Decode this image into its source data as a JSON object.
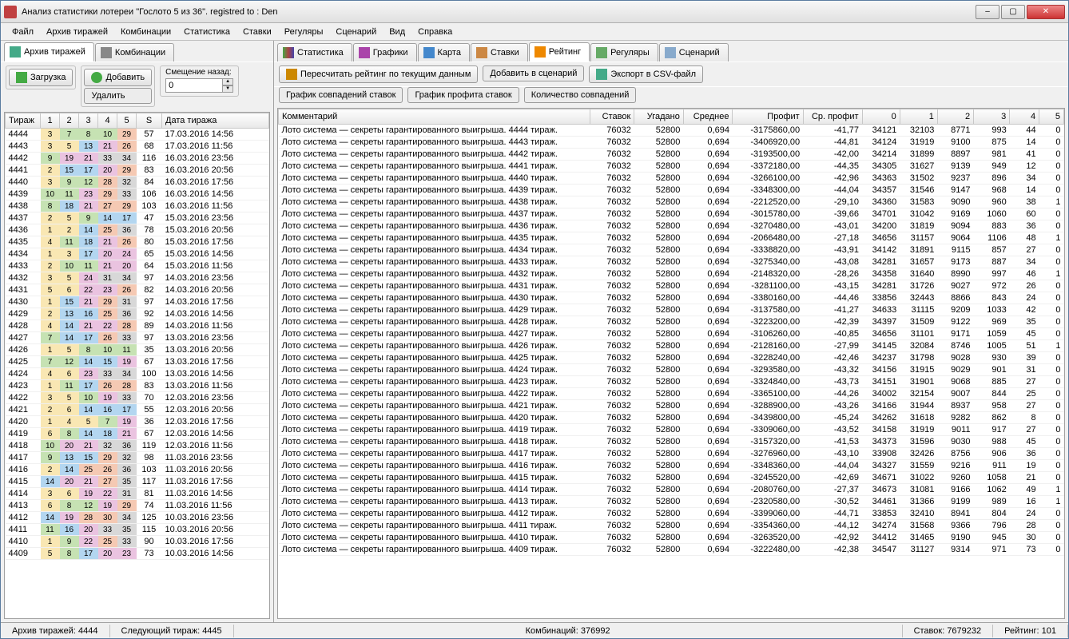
{
  "title": "Анализ статистики лотереи \"Гослото 5 из 36\". registred to : Den",
  "menu": [
    "Файл",
    "Архив тиражей",
    "Комбинации",
    "Статистика",
    "Ставки",
    "Регуляры",
    "Сценарий",
    "Вид",
    "Справка"
  ],
  "leftTabs": [
    {
      "label": "Архив тиражей"
    },
    {
      "label": "Комбинации"
    }
  ],
  "rightTabs": [
    {
      "label": "Статистика"
    },
    {
      "label": "Графики"
    },
    {
      "label": "Карта"
    },
    {
      "label": "Ставки"
    },
    {
      "label": "Рейтинг"
    },
    {
      "label": "Регуляры"
    },
    {
      "label": "Сценарий"
    }
  ],
  "leftToolbar": {
    "load": "Загрузка",
    "add": "Добавить",
    "del": "Удалить",
    "offsetLabel": "Смещение назад:",
    "offsetValue": "0"
  },
  "rightToolbar": {
    "recalc": "Пересчитать рейтинг по текущим данным",
    "addScenario": "Добавить в сценарий",
    "export": "Экспорт в CSV-файл",
    "g1": "График совпадений ставок",
    "g2": "График профита ставок",
    "g3": "Количество совпадений"
  },
  "leftHeaders": [
    "Тираж",
    "1",
    "2",
    "3",
    "4",
    "5",
    "S",
    "Дата тиража"
  ],
  "rightHeaders": [
    "Комментарий",
    "Ставок",
    "Угадано",
    "Среднее",
    "Профит",
    "Ср. профит",
    "0",
    "1",
    "2",
    "3",
    "4",
    "5"
  ],
  "draws": [
    {
      "t": "4444",
      "n": [
        3,
        7,
        8,
        10,
        29
      ],
      "s": 57,
      "d": "17.03.2016 14:56"
    },
    {
      "t": "4443",
      "n": [
        3,
        5,
        13,
        21,
        26
      ],
      "s": 68,
      "d": "17.03.2016 11:56"
    },
    {
      "t": "4442",
      "n": [
        9,
        19,
        21,
        33,
        34
      ],
      "s": 116,
      "d": "16.03.2016 23:56"
    },
    {
      "t": "4441",
      "n": [
        2,
        15,
        17,
        20,
        29
      ],
      "s": 83,
      "d": "16.03.2016 20:56"
    },
    {
      "t": "4440",
      "n": [
        3,
        9,
        12,
        28,
        32
      ],
      "s": 84,
      "d": "16.03.2016 17:56"
    },
    {
      "t": "4439",
      "n": [
        10,
        11,
        23,
        29,
        33
      ],
      "s": 106,
      "d": "16.03.2016 14:56"
    },
    {
      "t": "4438",
      "n": [
        8,
        18,
        21,
        27,
        29
      ],
      "s": 103,
      "d": "16.03.2016 11:56"
    },
    {
      "t": "4437",
      "n": [
        2,
        5,
        9,
        14,
        17
      ],
      "s": 47,
      "d": "15.03.2016 23:56"
    },
    {
      "t": "4436",
      "n": [
        1,
        2,
        14,
        25,
        36
      ],
      "s": 78,
      "d": "15.03.2016 20:56"
    },
    {
      "t": "4435",
      "n": [
        4,
        11,
        18,
        21,
        26
      ],
      "s": 80,
      "d": "15.03.2016 17:56"
    },
    {
      "t": "4434",
      "n": [
        1,
        3,
        17,
        20,
        24
      ],
      "s": 65,
      "d": "15.03.2016 14:56"
    },
    {
      "t": "4433",
      "n": [
        2,
        10,
        11,
        21,
        20
      ],
      "s": 64,
      "d": "15.03.2016 11:56"
    },
    {
      "t": "4432",
      "n": [
        3,
        5,
        24,
        31,
        34
      ],
      "s": 97,
      "d": "14.03.2016 23:56"
    },
    {
      "t": "4431",
      "n": [
        5,
        6,
        22,
        23,
        26
      ],
      "s": 82,
      "d": "14.03.2016 20:56"
    },
    {
      "t": "4430",
      "n": [
        1,
        15,
        21,
        29,
        31
      ],
      "s": 97,
      "d": "14.03.2016 17:56"
    },
    {
      "t": "4429",
      "n": [
        2,
        13,
        16,
        25,
        36
      ],
      "s": 92,
      "d": "14.03.2016 14:56"
    },
    {
      "t": "4428",
      "n": [
        4,
        14,
        21,
        22,
        28
      ],
      "s": 89,
      "d": "14.03.2016 11:56"
    },
    {
      "t": "4427",
      "n": [
        7,
        14,
        17,
        26,
        33
      ],
      "s": 97,
      "d": "13.03.2016 23:56"
    },
    {
      "t": "4426",
      "n": [
        1,
        5,
        8,
        10,
        11
      ],
      "s": 35,
      "d": "13.03.2016 20:56"
    },
    {
      "t": "4425",
      "n": [
        7,
        12,
        14,
        15,
        19
      ],
      "s": 67,
      "d": "13.03.2016 17:56"
    },
    {
      "t": "4424",
      "n": [
        4,
        6,
        23,
        33,
        34
      ],
      "s": 100,
      "d": "13.03.2016 14:56"
    },
    {
      "t": "4423",
      "n": [
        1,
        11,
        17,
        26,
        28
      ],
      "s": 83,
      "d": "13.03.2016 11:56"
    },
    {
      "t": "4422",
      "n": [
        3,
        5,
        10,
        19,
        33
      ],
      "s": 70,
      "d": "12.03.2016 23:56"
    },
    {
      "t": "4421",
      "n": [
        2,
        6,
        14,
        16,
        17
      ],
      "s": 55,
      "d": "12.03.2016 20:56"
    },
    {
      "t": "4420",
      "n": [
        1,
        4,
        5,
        7,
        19
      ],
      "s": 36,
      "d": "12.03.2016 17:56"
    },
    {
      "t": "4419",
      "n": [
        6,
        8,
        14,
        18,
        21
      ],
      "s": 67,
      "d": "12.03.2016 14:56"
    },
    {
      "t": "4418",
      "n": [
        10,
        20,
        21,
        32,
        36
      ],
      "s": 119,
      "d": "12.03.2016 11:56"
    },
    {
      "t": "4417",
      "n": [
        9,
        13,
        15,
        29,
        32
      ],
      "s": 98,
      "d": "11.03.2016 23:56"
    },
    {
      "t": "4416",
      "n": [
        2,
        14,
        25,
        26,
        36
      ],
      "s": 103,
      "d": "11.03.2016 20:56"
    },
    {
      "t": "4415",
      "n": [
        14,
        20,
        21,
        27,
        35
      ],
      "s": 117,
      "d": "11.03.2016 17:56"
    },
    {
      "t": "4414",
      "n": [
        3,
        6,
        19,
        22,
        31
      ],
      "s": 81,
      "d": "11.03.2016 14:56"
    },
    {
      "t": "4413",
      "n": [
        6,
        8,
        12,
        19,
        29
      ],
      "s": 74,
      "d": "11.03.2016 11:56"
    },
    {
      "t": "4412",
      "n": [
        14,
        19,
        28,
        30,
        34
      ],
      "s": 125,
      "d": "10.03.2016 23:56"
    },
    {
      "t": "4411",
      "n": [
        11,
        16,
        20,
        33,
        35
      ],
      "s": 115,
      "d": "10.03.2016 20:56"
    },
    {
      "t": "4410",
      "n": [
        1,
        9,
        22,
        25,
        33
      ],
      "s": 90,
      "d": "10.03.2016 17:56"
    },
    {
      "t": "4409",
      "n": [
        5,
        8,
        17,
        20,
        23
      ],
      "s": 73,
      "d": "10.03.2016 14:56"
    }
  ],
  "ratings": [
    {
      "c": "Лото система — секреты гарантированного выигрыша. 4444 тираж.",
      "st": "76032",
      "ug": "52800",
      "sr": "0,694",
      "pr": "-3175860,00",
      "sp": "-41,77",
      "m": [
        34121,
        32103,
        8771,
        993,
        44,
        0
      ]
    },
    {
      "c": "Лото система — секреты гарантированного выигрыша. 4443 тираж.",
      "st": "76032",
      "ug": "52800",
      "sr": "0,694",
      "pr": "-3406920,00",
      "sp": "-44,81",
      "m": [
        34124,
        31919,
        9100,
        875,
        14,
        0
      ]
    },
    {
      "c": "Лото система — секреты гарантированного выигрыша. 4442 тираж.",
      "st": "76032",
      "ug": "52800",
      "sr": "0,694",
      "pr": "-3193500,00",
      "sp": "-42,00",
      "m": [
        34214,
        31899,
        8897,
        981,
        41,
        0
      ]
    },
    {
      "c": "Лото система — секреты гарантированного выигрыша. 4441 тираж.",
      "st": "76032",
      "ug": "52800",
      "sr": "0,694",
      "pr": "-3372180,00",
      "sp": "-44,35",
      "m": [
        34305,
        31627,
        9139,
        949,
        12,
        0
      ]
    },
    {
      "c": "Лото система — секреты гарантированного выигрыша. 4440 тираж.",
      "st": "76032",
      "ug": "52800",
      "sr": "0,694",
      "pr": "-3266100,00",
      "sp": "-42,96",
      "m": [
        34363,
        31502,
        9237,
        896,
        34,
        0
      ]
    },
    {
      "c": "Лото система — секреты гарантированного выигрыша. 4439 тираж.",
      "st": "76032",
      "ug": "52800",
      "sr": "0,694",
      "pr": "-3348300,00",
      "sp": "-44,04",
      "m": [
        34357,
        31546,
        9147,
        968,
        14,
        0
      ]
    },
    {
      "c": "Лото система — секреты гарантированного выигрыша. 4438 тираж.",
      "st": "76032",
      "ug": "52800",
      "sr": "0,694",
      "pr": "-2212520,00",
      "sp": "-29,10",
      "m": [
        34360,
        31583,
        9090,
        960,
        38,
        1
      ]
    },
    {
      "c": "Лото система — секреты гарантированного выигрыша. 4437 тираж.",
      "st": "76032",
      "ug": "52800",
      "sr": "0,694",
      "pr": "-3015780,00",
      "sp": "-39,66",
      "m": [
        34701,
        31042,
        9169,
        1060,
        60,
        0
      ]
    },
    {
      "c": "Лото система — секреты гарантированного выигрыша. 4436 тираж.",
      "st": "76032",
      "ug": "52800",
      "sr": "0,694",
      "pr": "-3270480,00",
      "sp": "-43,01",
      "m": [
        34200,
        31819,
        9094,
        883,
        36,
        0
      ]
    },
    {
      "c": "Лото система — секреты гарантированного выигрыша. 4435 тираж.",
      "st": "76032",
      "ug": "52800",
      "sr": "0,694",
      "pr": "-2066480,00",
      "sp": "-27,18",
      "m": [
        34656,
        31157,
        9064,
        1106,
        48,
        1
      ]
    },
    {
      "c": "Лото система — секреты гарантированного выигрыша. 4434 тираж.",
      "st": "76032",
      "ug": "52800",
      "sr": "0,694",
      "pr": "-3338820,00",
      "sp": "-43,91",
      "m": [
        34142,
        31891,
        9115,
        857,
        27,
        0
      ]
    },
    {
      "c": "Лото система — секреты гарантированного выигрыша. 4433 тираж.",
      "st": "76032",
      "ug": "52800",
      "sr": "0,694",
      "pr": "-3275340,00",
      "sp": "-43,08",
      "m": [
        34281,
        31657,
        9173,
        887,
        34,
        0
      ]
    },
    {
      "c": "Лото система — секреты гарантированного выигрыша. 4432 тираж.",
      "st": "76032",
      "ug": "52800",
      "sr": "0,694",
      "pr": "-2148320,00",
      "sp": "-28,26",
      "m": [
        34358,
        31640,
        8990,
        997,
        46,
        1
      ]
    },
    {
      "c": "Лото система — секреты гарантированного выигрыша. 4431 тираж.",
      "st": "76032",
      "ug": "52800",
      "sr": "0,694",
      "pr": "-3281100,00",
      "sp": "-43,15",
      "m": [
        34281,
        31726,
        9027,
        972,
        26,
        0
      ]
    },
    {
      "c": "Лото система — секреты гарантированного выигрыша. 4430 тираж.",
      "st": "76032",
      "ug": "52800",
      "sr": "0,694",
      "pr": "-3380160,00",
      "sp": "-44,46",
      "m": [
        33856,
        32443,
        8866,
        843,
        24,
        0
      ]
    },
    {
      "c": "Лото система — секреты гарантированного выигрыша. 4429 тираж.",
      "st": "76032",
      "ug": "52800",
      "sr": "0,694",
      "pr": "-3137580,00",
      "sp": "-41,27",
      "m": [
        34633,
        31115,
        9209,
        1033,
        42,
        0
      ]
    },
    {
      "c": "Лото система — секреты гарантированного выигрыша. 4428 тираж.",
      "st": "76032",
      "ug": "52800",
      "sr": "0,694",
      "pr": "-3223200,00",
      "sp": "-42,39",
      "m": [
        34397,
        31509,
        9122,
        969,
        35,
        0
      ]
    },
    {
      "c": "Лото система — секреты гарантированного выигрыша. 4427 тираж.",
      "st": "76032",
      "ug": "52800",
      "sr": "0,694",
      "pr": "-3106260,00",
      "sp": "-40,85",
      "m": [
        34656,
        31101,
        9171,
        1059,
        45,
        0
      ]
    },
    {
      "c": "Лото система — секреты гарантированного выигрыша. 4426 тираж.",
      "st": "76032",
      "ug": "52800",
      "sr": "0,694",
      "pr": "-2128160,00",
      "sp": "-27,99",
      "m": [
        34145,
        32084,
        8746,
        1005,
        51,
        1
      ]
    },
    {
      "c": "Лото система — секреты гарантированного выигрыша. 4425 тираж.",
      "st": "76032",
      "ug": "52800",
      "sr": "0,694",
      "pr": "-3228240,00",
      "sp": "-42,46",
      "m": [
        34237,
        31798,
        9028,
        930,
        39,
        0
      ]
    },
    {
      "c": "Лото система — секреты гарантированного выигрыша. 4424 тираж.",
      "st": "76032",
      "ug": "52800",
      "sr": "0,694",
      "pr": "-3293580,00",
      "sp": "-43,32",
      "m": [
        34156,
        31915,
        9029,
        901,
        31,
        0
      ]
    },
    {
      "c": "Лото система — секреты гарантированного выигрыша. 4423 тираж.",
      "st": "76032",
      "ug": "52800",
      "sr": "0,694",
      "pr": "-3324840,00",
      "sp": "-43,73",
      "m": [
        34151,
        31901,
        9068,
        885,
        27,
        0
      ]
    },
    {
      "c": "Лото система — секреты гарантированного выигрыша. 4422 тираж.",
      "st": "76032",
      "ug": "52800",
      "sr": "0,694",
      "pr": "-3365100,00",
      "sp": "-44,26",
      "m": [
        34002,
        32154,
        9007,
        844,
        25,
        0
      ]
    },
    {
      "c": "Лото система — секреты гарантированного выигрыша. 4421 тираж.",
      "st": "76032",
      "ug": "52800",
      "sr": "0,694",
      "pr": "-3288900,00",
      "sp": "-43,26",
      "m": [
        34166,
        31944,
        8937,
        958,
        27,
        0
      ]
    },
    {
      "c": "Лото система — секреты гарантированного выигрыша. 4420 тираж.",
      "st": "76032",
      "ug": "52800",
      "sr": "0,694",
      "pr": "-3439800,00",
      "sp": "-45,24",
      "m": [
        34262,
        31618,
        9282,
        862,
        8,
        0
      ]
    },
    {
      "c": "Лото система — секреты гарантированного выигрыша. 4419 тираж.",
      "st": "76032",
      "ug": "52800",
      "sr": "0,694",
      "pr": "-3309060,00",
      "sp": "-43,52",
      "m": [
        34158,
        31919,
        9011,
        917,
        27,
        0
      ]
    },
    {
      "c": "Лото система — секреты гарантированного выигрыша. 4418 тираж.",
      "st": "76032",
      "ug": "52800",
      "sr": "0,694",
      "pr": "-3157320,00",
      "sp": "-41,53",
      "m": [
        34373,
        31596,
        9030,
        988,
        45,
        0
      ]
    },
    {
      "c": "Лото система — секреты гарантированного выигрыша. 4417 тираж.",
      "st": "76032",
      "ug": "52800",
      "sr": "0,694",
      "pr": "-3276960,00",
      "sp": "-43,10",
      "m": [
        33908,
        32426,
        8756,
        906,
        36,
        0
      ]
    },
    {
      "c": "Лото система — секреты гарантированного выигрыша. 4416 тираж.",
      "st": "76032",
      "ug": "52800",
      "sr": "0,694",
      "pr": "-3348360,00",
      "sp": "-44,04",
      "m": [
        34327,
        31559,
        9216,
        911,
        19,
        0
      ]
    },
    {
      "c": "Лото система — секреты гарантированного выигрыша. 4415 тираж.",
      "st": "76032",
      "ug": "52800",
      "sr": "0,694",
      "pr": "-3245520,00",
      "sp": "-42,69",
      "m": [
        34671,
        31022,
        9260,
        1058,
        21,
        0
      ]
    },
    {
      "c": "Лото система — секреты гарантированного выигрыша. 4414 тираж.",
      "st": "76032",
      "ug": "52800",
      "sr": "0,694",
      "pr": "-2080760,00",
      "sp": "-27,37",
      "m": [
        34673,
        31081,
        9166,
        1062,
        49,
        1
      ]
    },
    {
      "c": "Лото система — секреты гарантированного выигрыша. 4413 тираж.",
      "st": "76032",
      "ug": "52800",
      "sr": "0,694",
      "pr": "-2320580,00",
      "sp": "-30,52",
      "m": [
        34461,
        31366,
        9199,
        989,
        16,
        1
      ]
    },
    {
      "c": "Лото система — секреты гарантированного выигрыша. 4412 тираж.",
      "st": "76032",
      "ug": "52800",
      "sr": "0,694",
      "pr": "-3399060,00",
      "sp": "-44,71",
      "m": [
        33853,
        32410,
        8941,
        804,
        24,
        0
      ]
    },
    {
      "c": "Лото система — секреты гарантированного выигрыша. 4411 тираж.",
      "st": "76032",
      "ug": "52800",
      "sr": "0,694",
      "pr": "-3354360,00",
      "sp": "-44,12",
      "m": [
        34274,
        31568,
        9366,
        796,
        28,
        0
      ]
    },
    {
      "c": "Лото система — секреты гарантированного выигрыша. 4410 тираж.",
      "st": "76032",
      "ug": "52800",
      "sr": "0,694",
      "pr": "-3263520,00",
      "sp": "-42,92",
      "m": [
        34412,
        31465,
        9190,
        945,
        30,
        0
      ]
    },
    {
      "c": "Лото система — секреты гарантированного выигрыша. 4409 тираж.",
      "st": "76032",
      "ug": "52800",
      "sr": "0,694",
      "pr": "-3222480,00",
      "sp": "-42,38",
      "m": [
        34547,
        31127,
        9314,
        971,
        73,
        0
      ]
    }
  ],
  "status": {
    "archive": "Архив тиражей: 4444",
    "next": "Следующий тираж: 4445",
    "combos": "Комбинаций: 376992",
    "bets": "Ставок: 7679232",
    "rating": "Рейтинг: 101"
  }
}
